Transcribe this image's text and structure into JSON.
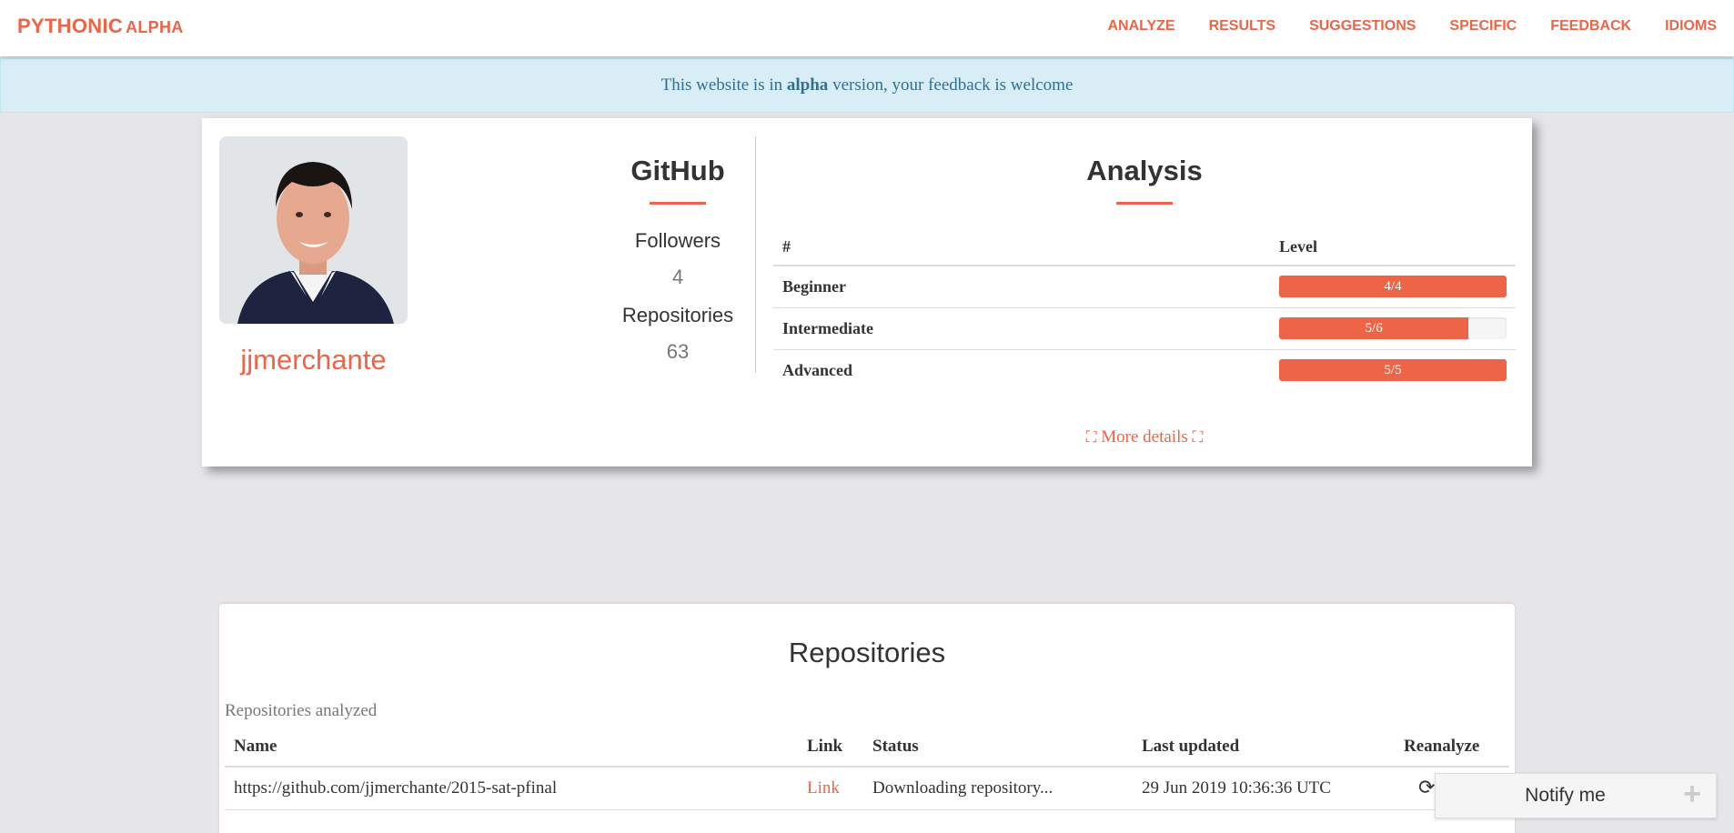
{
  "navbar": {
    "brand": "PYTHONIC",
    "brand_sub": "ALPHA",
    "links": [
      "ANALYZE",
      "RESULTS",
      "SUGGESTIONS",
      "SPECIFIC",
      "FEEDBACK",
      "IDIOMS"
    ]
  },
  "alert": {
    "prefix": "This website is in",
    "strong": "alpha",
    "suffix": "version, your feedback is welcome"
  },
  "profile": {
    "username": "jjmerchante",
    "github": {
      "title": "GitHub",
      "followers_label": "Followers",
      "followers": "4",
      "repos_label": "Repositories",
      "repos": "63"
    },
    "analysis": {
      "title": "Analysis",
      "col_hash": "#",
      "col_level": "Level",
      "rows": [
        {
          "name": "Beginner",
          "label": "4/4",
          "fraction": 1.0
        },
        {
          "name": "Intermediate",
          "label": "5/6",
          "fraction": 0.833
        },
        {
          "name": "Advanced",
          "label": "5/5",
          "fraction": 1.0
        }
      ],
      "more": "More details"
    }
  },
  "repositories": {
    "title": "Repositories",
    "subtitle": "Repositories analyzed",
    "columns": [
      "Name",
      "Link",
      "Status",
      "Last updated",
      "Reanalyze"
    ],
    "rows": [
      {
        "name": "https://github.com/jjmerchante/2015-sat-pfinal",
        "link": "Link",
        "status": "Downloading repository...",
        "updated": "29 Jun 2019 10:36:36 UTC"
      }
    ]
  },
  "notify": {
    "label": "Notify me",
    "plus": "+"
  },
  "colors": {
    "accent": "#ee6446",
    "alert_bg": "#d9edf7",
    "alert_text": "#31708f",
    "page_bg": "#e6e6e9"
  },
  "icons": {
    "expand": "expand-icon",
    "refresh": "refresh-icon",
    "plus": "plus-icon"
  }
}
